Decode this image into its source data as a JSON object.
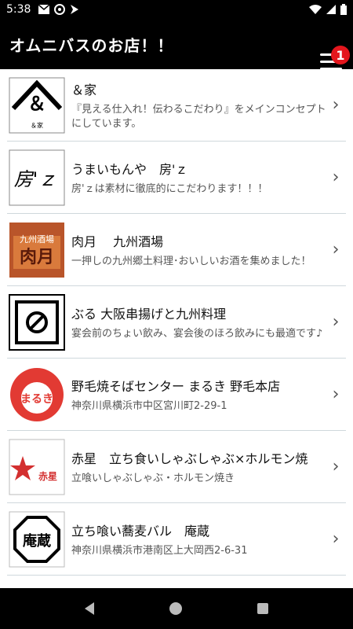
{
  "status": {
    "time": "5:38",
    "icons_left": [
      "mail-icon",
      "at-icon",
      "navigation-icon"
    ],
    "icons_right": [
      "wifi-icon",
      "signal-icon",
      "battery-icon"
    ]
  },
  "appbar": {
    "title": "オムニバスのお店！！",
    "badge": "1"
  },
  "thumbs": {
    "t0": "＆",
    "t0b": "＆家",
    "t1": "房'ｚ",
    "t2a": "九州酒場",
    "t2b": "肉月",
    "t4": "まるき",
    "t5": "赤星",
    "t6": "庵蔵"
  },
  "items": [
    {
      "name": "＆家",
      "desc": "『見える仕入れ！伝わるこだわり』をメインコンセプトにしています。"
    },
    {
      "name": "うまいもんや　房'ｚ",
      "desc": "房'ｚは素材に徹底的にこだわります！！！"
    },
    {
      "name": "肉月　 九州酒場",
      "desc": "一押しの九州郷土料理･おいしいお酒を集めました！"
    },
    {
      "name": "ぶる  大阪串揚げと九州料理",
      "desc": "宴会前のちょい飲み、宴会後のほろ飲みにも最適です♪"
    },
    {
      "name": "野毛焼そばセンター まるき 野毛本店",
      "desc": "神奈川県横浜市中区宮川町2-29-1"
    },
    {
      "name": "赤星　立ち食いしゃぶしゃぶ×ホルモン焼",
      "desc": "立喰いしゃぶしゃぶ・ホルモン焼き"
    },
    {
      "name": "立ち喰い蕎麦バル　庵蔵",
      "desc": "神奈川県横浜市港南区上大岡西2-6-31"
    }
  ],
  "colors": {
    "badge": "#e4161d",
    "divider": "#cfd8dc",
    "bar": "#000000"
  }
}
